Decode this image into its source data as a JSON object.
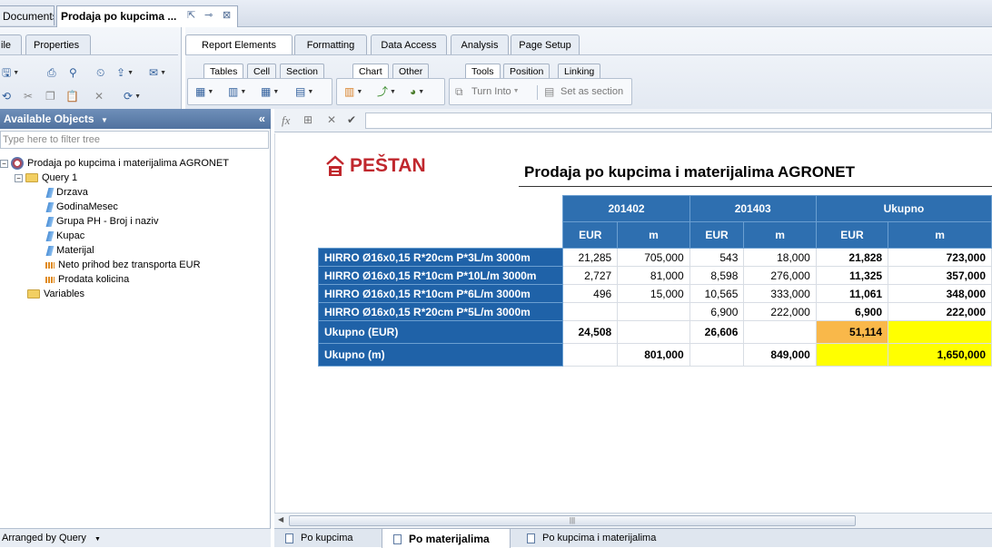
{
  "doc_tabs": {
    "documents": "Documents",
    "active": "Prodaja po kupcima ..."
  },
  "left_ribbon": {
    "tab_file": "ile",
    "tab_properties": "Properties"
  },
  "ribbon": {
    "tabs": [
      "Report Elements",
      "Formatting",
      "Data Access",
      "Analysis",
      "Page Setup"
    ],
    "sub_tabs": [
      "Tables",
      "Cell",
      "Section",
      "Chart",
      "Other",
      "Tools",
      "Position",
      "Linking"
    ],
    "turn_into": "Turn Into",
    "set_as_section": "Set as section"
  },
  "available_objects": {
    "title": "Available Objects",
    "filter_placeholder": "Type here to filter tree",
    "root": "Prodaja po kupcima i materijalima AGRONET",
    "query": "Query 1",
    "dimensions": [
      "Drzava",
      "GodinaMesec",
      "Grupa PH - Broj i naziv",
      "Kupac",
      "Materijal"
    ],
    "measures": [
      "Neto prihod bez transporta EUR",
      "Prodata kolicina"
    ],
    "variables": "Variables",
    "footer": "Arranged by Query"
  },
  "report": {
    "logo": "PEŠTAN",
    "title": "Prodaja po kupcima i materijalima AGRONET",
    "periods": [
      "201402",
      "201403",
      "Ukupno"
    ],
    "units": [
      "EUR",
      "m",
      "EUR",
      "m",
      "EUR",
      "m"
    ],
    "rows": [
      {
        "label": "HIRRO Ø16x0,15 R*20cm P*3L/m 3000m",
        "cells": [
          "21,285",
          "705,000",
          "543",
          "18,000",
          "21,828",
          "723,000"
        ]
      },
      {
        "label": "HIRRO Ø16x0,15 R*10cm P*10L/m 3000m",
        "cells": [
          "2,727",
          "81,000",
          "8,598",
          "276,000",
          "11,325",
          "357,000"
        ]
      },
      {
        "label": "HIRRO Ø16x0,15 R*10cm P*6L/m 3000m",
        "cells": [
          "496",
          "15,000",
          "10,565",
          "333,000",
          "11,061",
          "348,000"
        ]
      },
      {
        "label": "HIRRO Ø16x0,15 R*20cm P*5L/m 3000m",
        "cells": [
          "",
          "",
          "6,900",
          "222,000",
          "6,900",
          "222,000"
        ]
      }
    ],
    "total_eur": {
      "label": "Ukupno (EUR)",
      "cells": [
        "24,508",
        "",
        "26,606",
        "",
        "51,114",
        ""
      ]
    },
    "total_m": {
      "label": "Ukupno (m)",
      "cells": [
        "",
        "801,000",
        "",
        "849,000",
        "",
        "1,650,000"
      ]
    }
  },
  "bottom_tabs": [
    "Po kupcima",
    "Po materijalima",
    "Po kupcima i materijalima"
  ],
  "colors": {
    "header_blue": "#2e6fb0",
    "row_blue": "#1f62a8",
    "orange": "#f9b84a",
    "yellow": "#ffff00",
    "logo_red": "#c0272d"
  }
}
